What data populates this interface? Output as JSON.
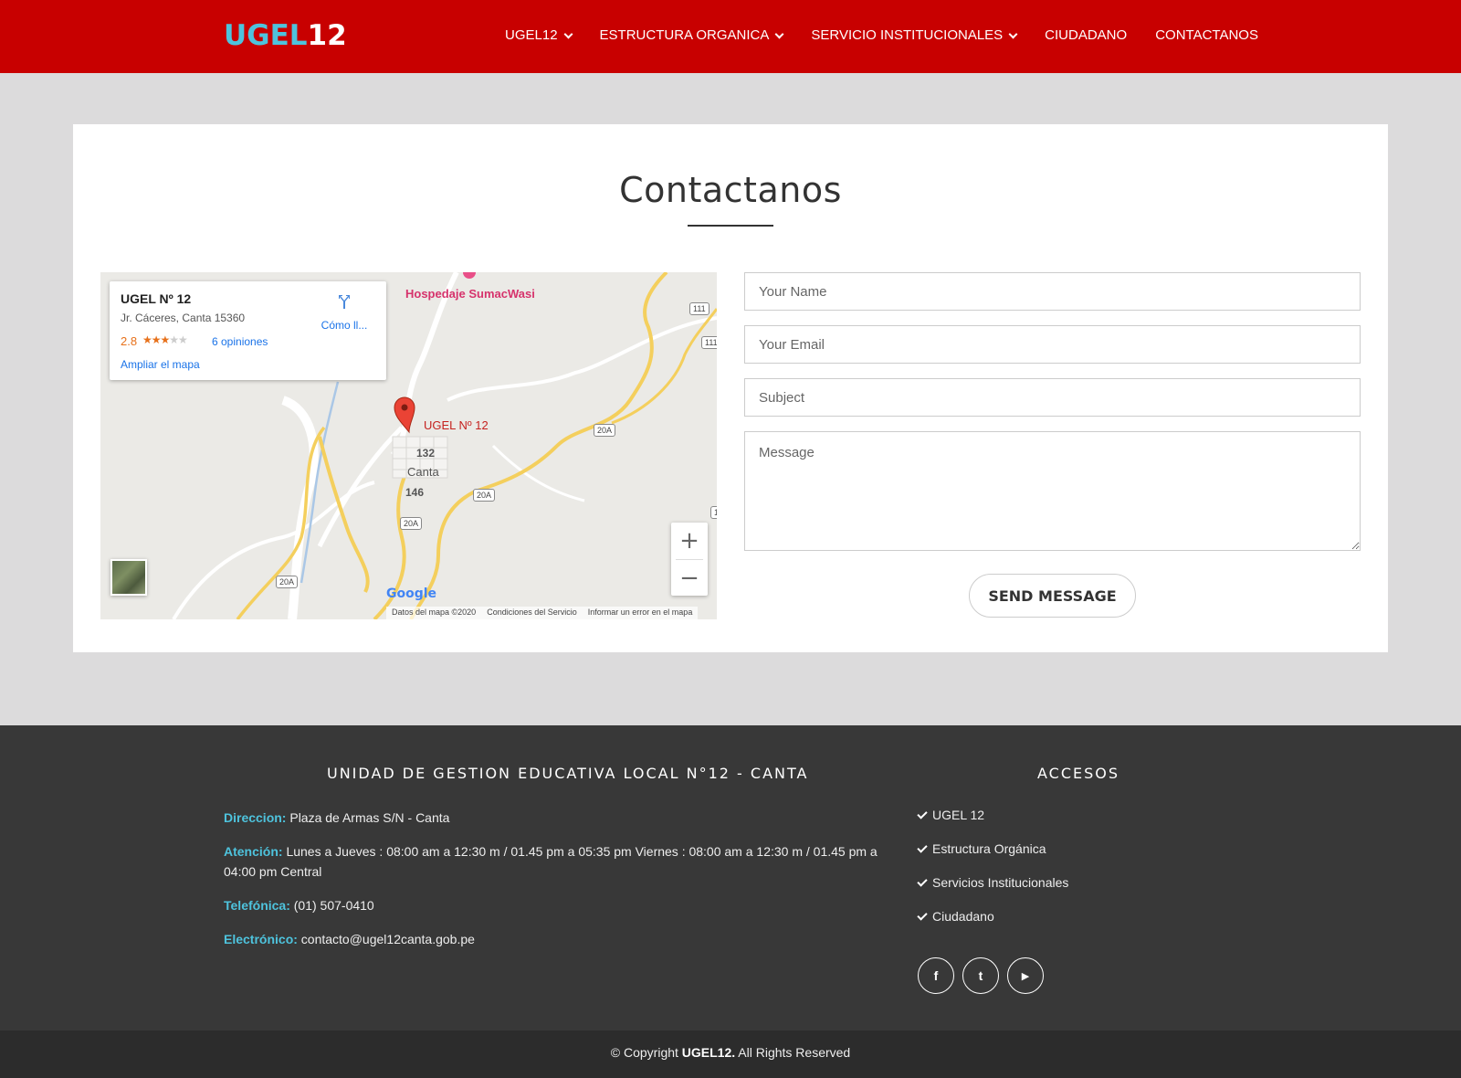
{
  "header": {
    "logo_part1": "UGEL",
    "logo_part2": "12",
    "nav": [
      {
        "label": "UGEL12",
        "has_dropdown": true
      },
      {
        "label": "ESTRUCTURA ORGANICA",
        "has_dropdown": true
      },
      {
        "label": "SERVICIO INSTITUCIONALES",
        "has_dropdown": true
      },
      {
        "label": "CIUDADANO",
        "has_dropdown": false
      },
      {
        "label": "CONTACTANOS",
        "has_dropdown": false
      }
    ]
  },
  "main": {
    "title": "Contactanos"
  },
  "map": {
    "place_name": "UGEL Nº 12",
    "address": "Jr. Cáceres, Canta 15360",
    "rating": "2.8",
    "rating_value": 2.8,
    "reviews": "6 opiniones",
    "directions": "Cómo ll...",
    "enlarge": "Ampliar el mapa",
    "marker_label": "UGEL Nº 12",
    "poi_label": "Hospedaje SumacWasi",
    "town_label": "Canta",
    "block_labels": [
      "132",
      "146"
    ],
    "road_labels": [
      "111",
      "111",
      "20A",
      "20A",
      "20A",
      "20A",
      "1"
    ],
    "zoom_in": "+",
    "zoom_out": "−",
    "google": "Google",
    "footer_links": [
      "Datos del mapa ©2020",
      "Condiciones del Servicio",
      "Informar un error en el mapa"
    ]
  },
  "form": {
    "name_placeholder": "Your Name",
    "email_placeholder": "Your Email",
    "subject_placeholder": "Subject",
    "message_placeholder": "Message",
    "send_label": "SEND MESSAGE"
  },
  "footer": {
    "left_heading": "UNIDAD DE GESTION EDUCATIVA LOCAL N°12 - CANTA",
    "right_heading": "ACCESOS",
    "direccion_label": "Direccion:",
    "direccion_value": "Plaza de Armas S/N - Canta",
    "atencion_label": "Atención:",
    "atencion_value": "Lunes a Jueves : 08:00 am a 12:30 m / 01.45 pm a 05:35 pm Viernes : 08:00 am a 12:30 m / 01.45 pm a 04:00 pm Central",
    "telefonica_label": "Telefónica:",
    "telefonica_value": "(01) 507-0410",
    "electronico_label": "Electrónico:",
    "electronico_value": "contacto@ugel12canta.gob.pe",
    "accesos": [
      "UGEL 12",
      "Estructura Orgánica",
      "Servicios Institucionales",
      "Ciudadano"
    ],
    "social": [
      {
        "icon": "facebook-icon",
        "glyph": "f"
      },
      {
        "icon": "twitter-icon",
        "glyph": "t"
      },
      {
        "icon": "youtube-icon",
        "glyph": "▶"
      }
    ],
    "copyright_prefix": "© Copyright",
    "copyright_brand": "UGEL12.",
    "copyright_suffix": "All Rights Reserved"
  },
  "colors": {
    "header_bg": "#c80000",
    "accent": "#4ec3dd",
    "footer_bg": "#383838",
    "page_bg": "#dcdbdc"
  }
}
